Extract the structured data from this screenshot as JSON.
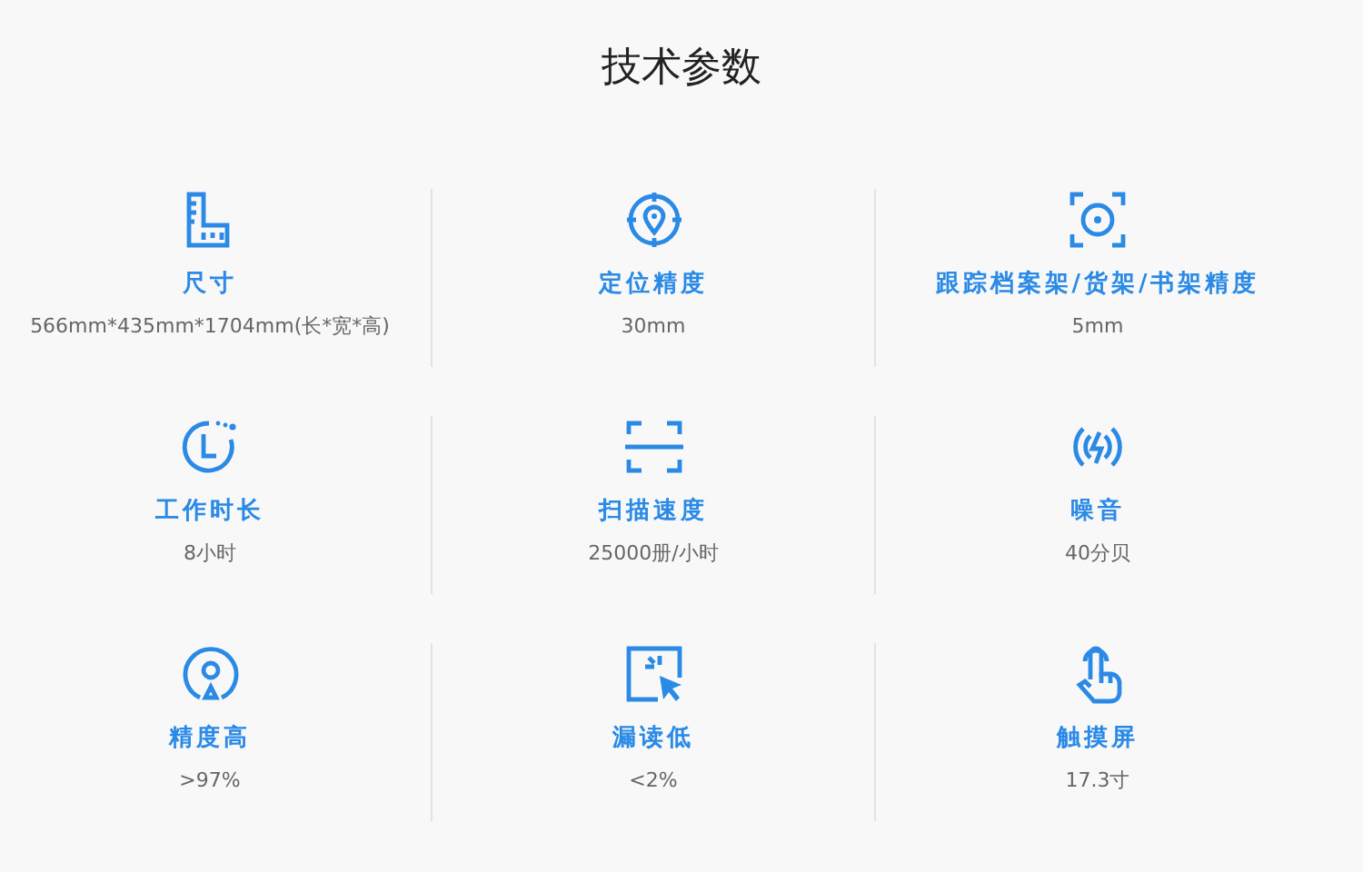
{
  "title": "技术参数",
  "specs": [
    {
      "label": "尺寸",
      "value": "566mm*435mm*1704mm(长*宽*高)"
    },
    {
      "label": "定位精度",
      "value": "30mm"
    },
    {
      "label": "跟踪档案架/货架/书架精度",
      "value": "5mm"
    },
    {
      "label": "工作时长",
      "value": "8小时"
    },
    {
      "label": "扫描速度",
      "value": "25000册/小时"
    },
    {
      "label": "噪音",
      "value": "40分贝"
    },
    {
      "label": "精度高",
      "value": ">97%"
    },
    {
      "label": "漏读低",
      "value": "<2%"
    },
    {
      "label": "触摸屏",
      "value": "17.3寸"
    }
  ]
}
